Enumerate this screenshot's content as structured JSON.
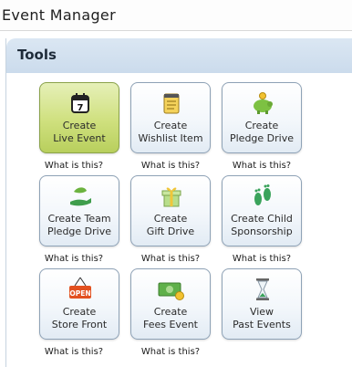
{
  "app": {
    "title": "Event Manager"
  },
  "panel": {
    "title": "Tools"
  },
  "tiles": [
    {
      "line1": "Create",
      "line2": "Live Event",
      "icon": "calendar-icon",
      "active": true
    },
    {
      "line1": "Create",
      "line2": "Wishlist Item",
      "icon": "notepad-icon"
    },
    {
      "line1": "Create",
      "line2": "Pledge Drive",
      "icon": "piggy-bank-icon"
    },
    {
      "line1": "Create Team",
      "line2": "Pledge Drive",
      "icon": "hand-leaf-icon"
    },
    {
      "line1": "Create",
      "line2": "Gift Drive",
      "icon": "gift-icon"
    },
    {
      "line1": "Create Child",
      "line2": "Sponsorship",
      "icon": "footprints-icon"
    },
    {
      "line1": "Create",
      "line2": "Store Front",
      "icon": "open-sign-icon"
    },
    {
      "line1": "Create",
      "line2": "Fees Event",
      "icon": "money-icon"
    },
    {
      "line1": "View",
      "line2": "Past Events",
      "icon": "hourglass-icon"
    }
  ],
  "help_label": "What is this?"
}
